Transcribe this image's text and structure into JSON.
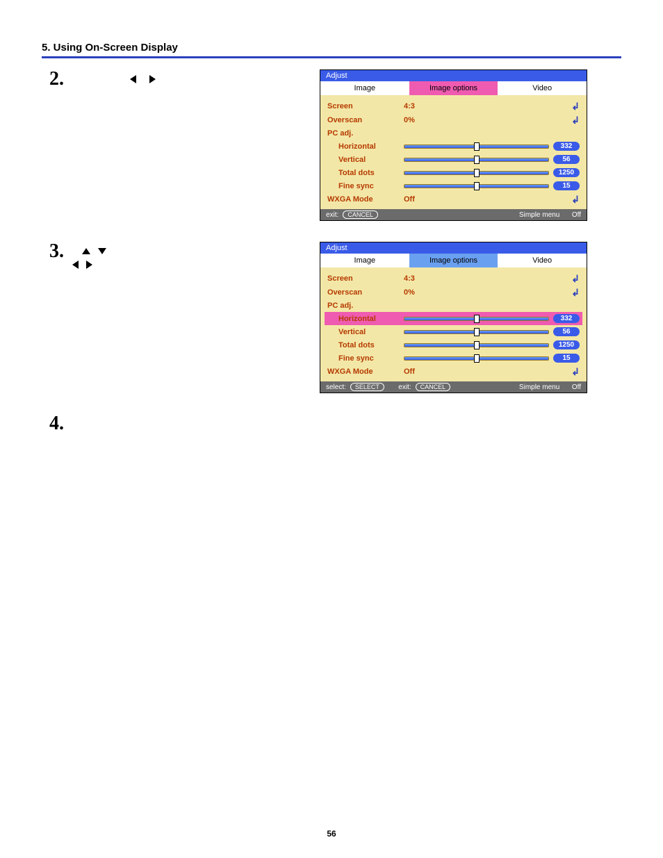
{
  "header": "5. Using On-Screen Display",
  "pageNumber": "56",
  "steps": {
    "s2": {
      "num": "2."
    },
    "s3": {
      "num": "3."
    },
    "s4": {
      "num": "4."
    }
  },
  "osd": {
    "title": "Adjust",
    "tabs": {
      "image": "Image",
      "imageOptions": "Image options",
      "video": "Video"
    },
    "rows": {
      "screen": {
        "label": "Screen",
        "value": "4:3"
      },
      "overscan": {
        "label": "Overscan",
        "value": "0%"
      },
      "pcadj": {
        "label": "PC adj."
      },
      "horizontal": {
        "label": "Horizontal",
        "pill": "332"
      },
      "vertical": {
        "label": "Vertical",
        "pill": "56"
      },
      "totaldots": {
        "label": "Total dots",
        "pill": "1250"
      },
      "finesync": {
        "label": "Fine sync",
        "pill": "15"
      },
      "wxga": {
        "label": "WXGA Mode",
        "value": "Off"
      }
    },
    "footer": {
      "exitLabel": "exit:",
      "exitBtn": "CANCEL",
      "selectLabel": "select:",
      "selectBtn": "SELECT",
      "simpleMenu": "Simple menu",
      "simpleVal": "Off"
    }
  }
}
